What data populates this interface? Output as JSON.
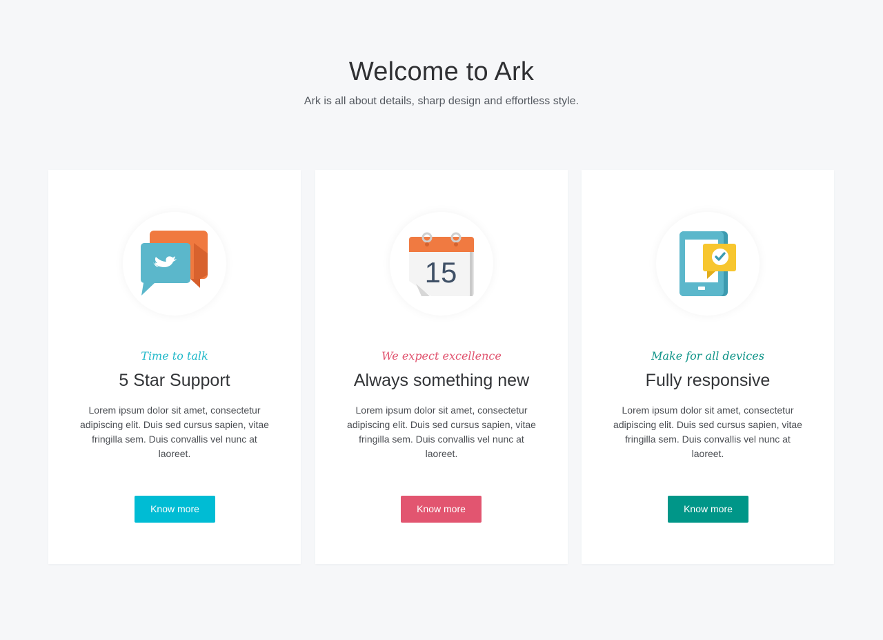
{
  "hero": {
    "title": "Welcome to Ark",
    "subtitle": "Ark is all about details, sharp design and effortless style."
  },
  "cards": [
    {
      "icon": "chat-bubbles-icon",
      "tagline": "Time to talk",
      "title": "5 Star Support",
      "text": "Lorem ipsum dolor sit amet, consectetur adipiscing elit. Duis sed cursus sapien, vitae fringilla sem. Duis convallis vel nunc at laoreet.",
      "button_label": "Know more",
      "accent": "#00bcd4"
    },
    {
      "icon": "calendar-icon",
      "icon_text": "15",
      "tagline": "We expect excellence",
      "title": "Always something new",
      "text": "Lorem ipsum dolor sit amet, consectetur adipiscing elit. Duis sed cursus sapien, vitae fringilla sem. Duis convallis vel nunc at laoreet.",
      "button_label": "Know more",
      "accent": "#e25570"
    },
    {
      "icon": "mobile-check-icon",
      "tagline": "Make for all devices",
      "title": "Fully responsive",
      "text": "Lorem ipsum dolor sit amet, consectetur adipiscing elit. Duis sed cursus sapien, vitae fringilla sem. Duis convallis vel nunc at laoreet.",
      "button_label": "Know more",
      "accent": "#009688"
    }
  ]
}
